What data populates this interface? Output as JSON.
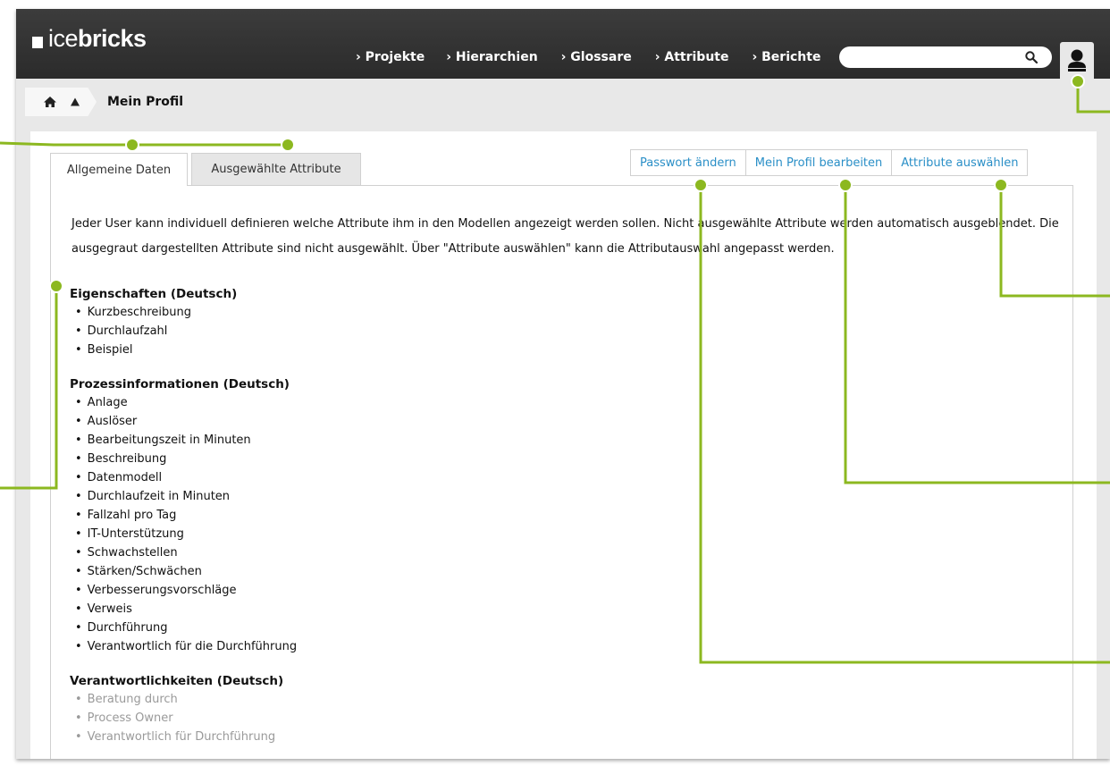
{
  "app": {
    "logo_prefix": "ice",
    "logo_bold": "bricks"
  },
  "nav": {
    "items": [
      "› Projekte",
      "› Hierarchien",
      "› Glossare",
      "› Attribute",
      "› Berichte"
    ]
  },
  "search": {
    "placeholder": "",
    "icon": "search-icon"
  },
  "user": {
    "icon": "user-icon"
  },
  "breadcrumb": {
    "home_icon": "home-icon",
    "up_icon": "up-arrow-icon",
    "title": "Mein Profil"
  },
  "tabs": [
    {
      "label": "Allgemeine Daten",
      "active": true
    },
    {
      "label": "Ausgewählte Attribute",
      "active": false
    }
  ],
  "actions": [
    "Passwort ändern",
    "Mein Profil bearbeiten",
    "Attribute auswählen"
  ],
  "intro": "Jeder User kann individuell definieren welche Attribute ihm in den Modellen angezeigt werden sollen. Nicht ausgewählte Attribute werden automatisch ausgeblendet. Die ausgegraut dargestellten Attribute sind nicht ausgewählt. Über \"Attribute auswählen\" kann die Attributauswahl angepasst werden.",
  "sections": [
    {
      "title": "Eigenschaften (Deutsch)",
      "greyed": false,
      "items": [
        "Kurzbeschreibung",
        "Durchlaufzahl",
        "Beispiel"
      ]
    },
    {
      "title": "Prozessinformationen (Deutsch)",
      "greyed": false,
      "items": [
        "Anlage",
        "Auslöser",
        "Bearbeitungszeit in Minuten",
        "Beschreibung",
        "Datenmodell",
        "Durchlaufzeit in Minuten",
        "Fallzahl pro Tag",
        "IT-Unterstützung",
        "Schwachstellen",
        "Stärken/Schwächen",
        "Verbesserungsvorschläge",
        "Verweis",
        "Durchführung",
        "Verantwortlich für die Durchführung"
      ]
    },
    {
      "title": "Verantwortlichkeiten (Deutsch)",
      "greyed": true,
      "items": [
        "Beratung durch",
        "Process Owner",
        "Verantwortlich für Durchführung"
      ]
    }
  ],
  "colors": {
    "topbar": "#2f2f2f",
    "link": "#2a8fc7",
    "callout": "#8cb820",
    "greyed_text": "#9a9a9a"
  }
}
